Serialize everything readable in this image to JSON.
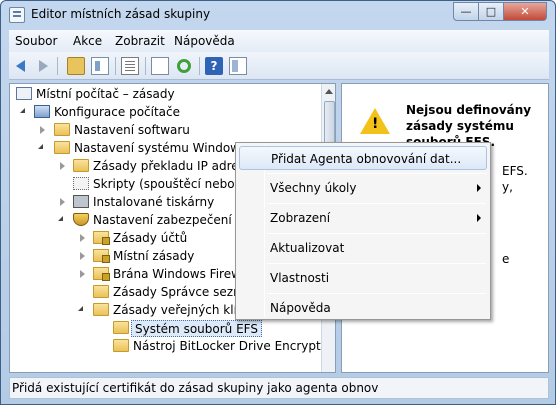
{
  "window": {
    "title": "Editor místních zásad skupiny",
    "minimize": "—",
    "maximize": "□",
    "close": "✕"
  },
  "menu": [
    "Soubor",
    "Akce",
    "Zobrazit",
    "Nápověda"
  ],
  "toolbar": {
    "icons": [
      "back-icon",
      "forward-icon",
      "up-folder-icon",
      "show-tree-icon",
      "properties-icon",
      "export-list-icon",
      "refresh-icon",
      "help-icon",
      "action-pane-icon"
    ],
    "help_glyph": "?"
  },
  "tree": [
    {
      "label": "Místní počítač – zásady",
      "icon": "policy-root-icon",
      "expander": "none",
      "state": "normal"
    },
    {
      "label": "Konfigurace počítače",
      "icon": "computer-icon",
      "expander": "open",
      "state": "normal"
    },
    {
      "label": "Nastavení softwaru",
      "icon": "folder-icon",
      "expander": "closed",
      "state": "normal"
    },
    {
      "label": "Nastavení systému Windows",
      "icon": "folder-icon",
      "expander": "open",
      "state": "normal"
    },
    {
      "label": "Zásady překladu IP adres",
      "icon": "folder-icon",
      "expander": "closed",
      "state": "normal"
    },
    {
      "label": "Skripty (spouštěcí nebo uko",
      "icon": "scripts-icon",
      "expander": "none",
      "state": "normal"
    },
    {
      "label": "Instalované tiskárny",
      "icon": "printer-icon",
      "expander": "closed",
      "state": "normal"
    },
    {
      "label": "Nastavení zabezpečení",
      "icon": "security-icon",
      "expander": "open",
      "state": "normal"
    },
    {
      "label": "Zásady účtů",
      "icon": "folder-lock-icon",
      "expander": "closed",
      "state": "normal"
    },
    {
      "label": "Místní zásady",
      "icon": "folder-lock-icon",
      "expander": "closed",
      "state": "normal"
    },
    {
      "label": "Brána Windows Firewall",
      "icon": "folder-lock-icon",
      "expander": "closed",
      "state": "normal"
    },
    {
      "label": "Zásady Správce seznam",
      "icon": "folder-icon",
      "expander": "none",
      "state": "normal"
    },
    {
      "label": "Zásady veřejných klíčů",
      "icon": "folder-icon",
      "expander": "open",
      "state": "normal"
    },
    {
      "label": "Systém souborů EFS",
      "icon": "folder-icon",
      "expander": "none",
      "state": "selected"
    },
    {
      "label": "Nástroj BitLocker Drive Encryption",
      "icon": "folder-icon",
      "expander": "none",
      "state": "normal"
    }
  ],
  "right_pane": {
    "heading": "Nejsou definovány zásady systému souborů EFS.",
    "text_fragments": [
      "EFS.",
      "y,",
      "e"
    ]
  },
  "context_menu": [
    {
      "label": "Přidat Agenta obnovování dat...",
      "submenu": false,
      "highlighted": true
    },
    {
      "label": "Všechny úkoly",
      "submenu": true,
      "highlighted": false
    },
    {
      "label": "Zobrazení",
      "submenu": true,
      "highlighted": false
    },
    {
      "label": "Aktualizovat",
      "submenu": false,
      "highlighted": false
    },
    {
      "label": "Vlastnosti",
      "submenu": false,
      "highlighted": false
    },
    {
      "label": "Nápověda",
      "submenu": false,
      "highlighted": false
    }
  ],
  "status": "Přidá existující certifikát do zásad skupiny jako agenta obnov",
  "colors": {
    "title_bar": "#c3d7ee",
    "selection": "#dce9f8",
    "warning": "#f2c21b"
  }
}
